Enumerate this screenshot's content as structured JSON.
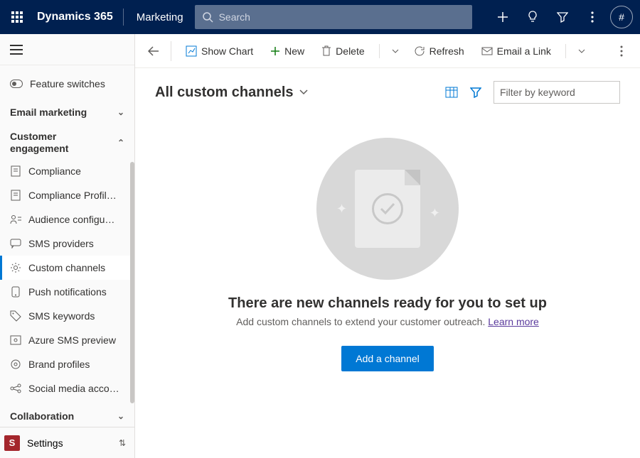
{
  "topbar": {
    "app": "Dynamics 365",
    "area": "Marketing",
    "search_placeholder": "Search",
    "avatar_char": "#"
  },
  "sidebar": {
    "feature_switches": "Feature switches",
    "groups": {
      "email_marketing": {
        "title": "Email marketing"
      },
      "customer_engagement": {
        "title": "Customer engagement",
        "items": [
          {
            "label": "Compliance"
          },
          {
            "label": "Compliance Profil…"
          },
          {
            "label": "Audience configu…"
          },
          {
            "label": "SMS providers"
          },
          {
            "label": "Custom channels",
            "active": true
          },
          {
            "label": "Push notifications"
          },
          {
            "label": "SMS keywords"
          },
          {
            "label": "Azure SMS preview"
          },
          {
            "label": "Brand profiles"
          },
          {
            "label": "Social media acco…"
          }
        ]
      },
      "collaboration": {
        "title": "Collaboration"
      }
    },
    "footer": {
      "badge": "S",
      "label": "Settings"
    }
  },
  "commandbar": {
    "show_chart": "Show Chart",
    "new": "New",
    "delete": "Delete",
    "refresh": "Refresh",
    "email_link": "Email a Link"
  },
  "subheader": {
    "view_name": "All custom channels",
    "filter_placeholder": "Filter by keyword"
  },
  "empty_state": {
    "title": "There are new channels ready for you to set up",
    "subtitle": "Add custom channels to extend your customer outreach.",
    "learn_more": "Learn more",
    "button": "Add a channel"
  }
}
